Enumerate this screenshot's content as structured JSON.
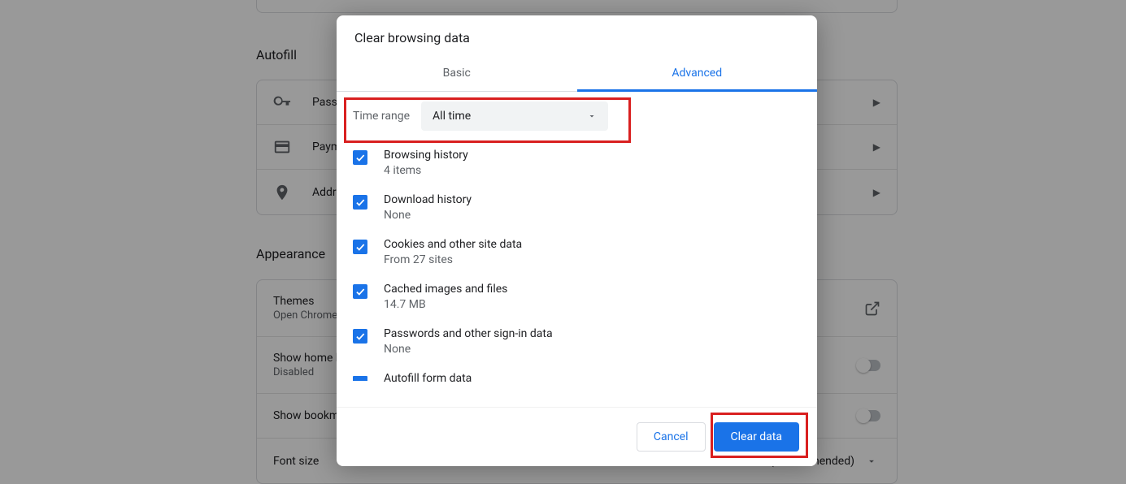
{
  "bg": {
    "autofill": {
      "title": "Autofill",
      "rows": {
        "passwords": "Passwords",
        "payment": "Payment methods",
        "addresses": "Addresses and more"
      }
    },
    "appearance": {
      "title": "Appearance",
      "themes": {
        "title": "Themes",
        "sub": "Open Chrome Web Store"
      },
      "home": {
        "title": "Show home button",
        "sub": "Disabled"
      },
      "bookmarks": {
        "title": "Show bookmarks bar"
      },
      "fontsize": {
        "title": "Font size",
        "value": "Medium (Recommended)"
      }
    }
  },
  "dialog": {
    "title": "Clear browsing data",
    "tabs": {
      "basic": "Basic",
      "advanced": "Advanced"
    },
    "timerange": {
      "label": "Time range",
      "value": "All time"
    },
    "items": [
      {
        "title": "Browsing history",
        "sub": "4 items"
      },
      {
        "title": "Download history",
        "sub": "None"
      },
      {
        "title": "Cookies and other site data",
        "sub": "From 27 sites"
      },
      {
        "title": "Cached images and files",
        "sub": "14.7 MB"
      },
      {
        "title": "Passwords and other sign-in data",
        "sub": "None"
      }
    ],
    "partial": {
      "title": "Autofill form data"
    },
    "actions": {
      "cancel": "Cancel",
      "clear": "Clear data"
    }
  }
}
